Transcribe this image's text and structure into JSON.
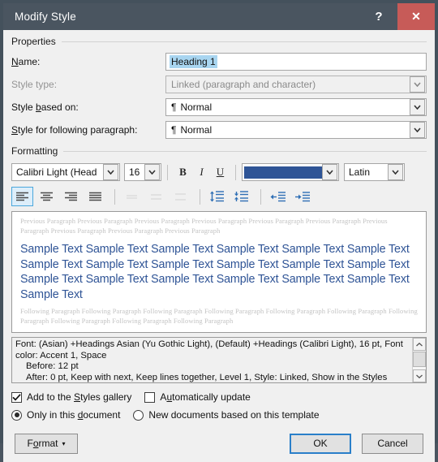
{
  "window": {
    "title": "Modify Style",
    "help_label": "?",
    "close_label": "✕"
  },
  "properties": {
    "group_label": "Properties",
    "name_label": "Name:",
    "name_value": "Heading 1",
    "style_type_label": "Style type:",
    "style_type_value": "Linked (paragraph and character)",
    "based_on_label": "Style based on:",
    "based_on_value": "Normal",
    "following_label": "Style for following paragraph:",
    "following_value": "Normal",
    "pilcrow": "¶"
  },
  "formatting": {
    "group_label": "Formatting",
    "font_name": "Calibri Light (Head",
    "font_size": "16",
    "bold_label": "B",
    "italic_label": "I",
    "underline_label": "U",
    "font_color": "#2e5496",
    "script": "Latin",
    "align_buttons": [
      "align-left",
      "align-center",
      "align-right",
      "align-justify"
    ],
    "linespacing_buttons": [
      "line-spacing-single",
      "line-spacing-1-5",
      "line-spacing-double"
    ],
    "spacing_buttons": [
      "increase-paragraph-spacing",
      "decrease-paragraph-spacing"
    ],
    "indent_buttons": [
      "decrease-indent",
      "increase-indent"
    ]
  },
  "preview": {
    "previous_paragraph": "Previous Paragraph Previous Paragraph Previous Paragraph Previous Paragraph Previous Paragraph Previous Paragraph Previous Paragraph Previous Paragraph Previous Paragraph Previous Paragraph",
    "sample_text": "Sample Text Sample Text Sample Text Sample Text Sample Text Sample Text Sample Text Sample Text Sample Text Sample Text Sample Text Sample Text Sample Text Sample Text Sample Text Sample Text Sample Text Sample Text Sample Text",
    "following_paragraph": "Following Paragraph Following Paragraph Following Paragraph Following Paragraph Following Paragraph Following Paragraph Following Paragraph Following Paragraph Following Paragraph Following Paragraph"
  },
  "description": {
    "line1": "Font: (Asian) +Headings Asian (Yu Gothic Light), (Default) +Headings (Calibri Light), 16 pt,",
    "line2": "Font color: Accent 1, Space",
    "line3": "Before:  12 pt",
    "line4": "After:  0 pt, Keep with next, Keep lines together, Level 1, Style: Linked, Show in the Styles"
  },
  "options": {
    "add_gallery_label": "Add to the Styles gallery",
    "add_gallery_checked": true,
    "auto_update_label": "Automatically update",
    "auto_update_checked": false,
    "only_document_label": "Only in this document",
    "only_document_selected": true,
    "new_documents_label": "New documents based on this template",
    "new_documents_selected": false
  },
  "footer": {
    "format_label": "Format",
    "format_caret": "▾",
    "ok_label": "OK",
    "cancel_label": "Cancel"
  }
}
